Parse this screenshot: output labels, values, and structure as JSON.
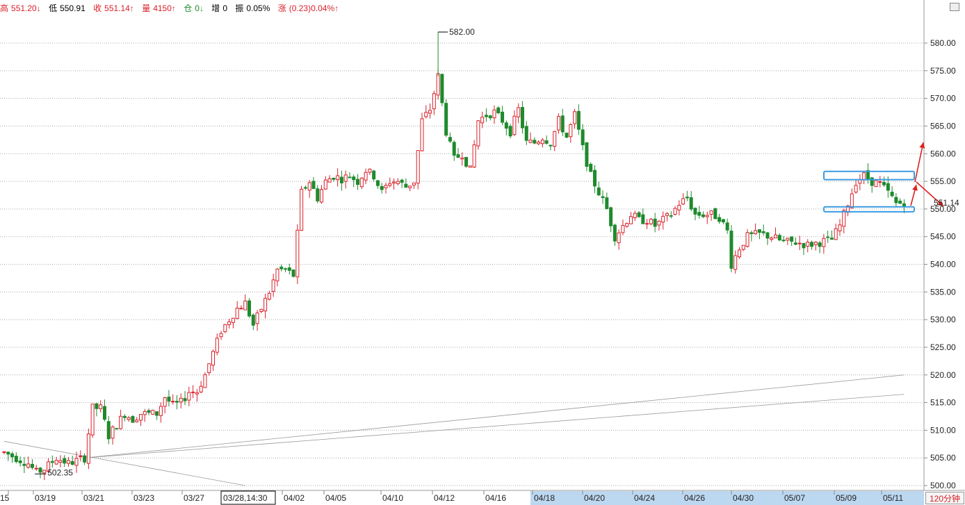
{
  "status": {
    "high_label": "高",
    "high_value": "551.20↓",
    "low_label": "低",
    "low_value": "550.91",
    "close_label": "收",
    "close_value": "551.14↑",
    "volume_label": "量",
    "volume_value": "4150↑",
    "oi_label": "仓",
    "oi_value": "0↓",
    "oi_change_label": "增",
    "oi_change_value": "0",
    "amplitude_label": "振",
    "amplitude_value": "0.05%",
    "change_label": "涨",
    "change_value": "(0.23)0.04%↑"
  },
  "timeframe": "120分钟",
  "cursor_time": "03/28,14:30",
  "colors": {
    "up": "#d9202a",
    "down": "#1e8a2c",
    "highlight_box": "#3a9be0",
    "arrow": "#e02020",
    "date_highlight": "#bcd7f0"
  },
  "chart_data": {
    "type": "candlestick",
    "ylim": [
      500,
      584
    ],
    "grid": true,
    "price_axis_side": "right",
    "price_ticks": [
      "580.00",
      "575.00",
      "570.00",
      "565.00",
      "560.00",
      "555.00",
      "550.00",
      "545.00",
      "540.00",
      "535.00",
      "530.00",
      "525.00",
      "520.00",
      "515.00",
      "510.00",
      "505.00",
      "500.00"
    ],
    "price_tick_values": [
      580,
      575,
      570,
      565,
      560,
      555,
      550,
      545,
      540,
      535,
      530,
      525,
      520,
      515,
      510,
      505,
      500
    ],
    "date_labels": [
      "15",
      "03/19",
      "03/21",
      "03/23",
      "03/27",
      "04/02",
      "04/05",
      "04/10",
      "04/12",
      "04/16",
      "04/18",
      "04/20",
      "04/24",
      "04/26",
      "04/30",
      "05/07",
      "05/09",
      "05/11"
    ],
    "last_price_label": "551.14",
    "annotations": [
      {
        "text": "582.00",
        "value": 582.0,
        "kind": "high"
      },
      {
        "text": "502.35",
        "value": 502.35,
        "kind": "low"
      }
    ],
    "zones": [
      {
        "low": 555.3,
        "high": 556.8
      },
      {
        "low": 549.5,
        "high": 550.4
      }
    ],
    "path_points": [
      [
        0,
        506
      ],
      [
        6,
        504
      ],
      [
        8,
        502.35
      ],
      [
        10,
        503
      ],
      [
        13,
        505
      ],
      [
        16,
        504
      ],
      [
        18,
        504.5
      ],
      [
        20,
        505
      ],
      [
        22,
        514
      ],
      [
        24,
        514
      ],
      [
        26,
        509
      ],
      [
        28,
        511
      ],
      [
        30,
        513
      ],
      [
        32,
        512
      ],
      [
        34,
        513
      ],
      [
        36,
        513
      ],
      [
        38,
        513
      ],
      [
        40,
        516
      ],
      [
        42,
        514.5
      ],
      [
        44,
        515
      ],
      [
        46,
        517
      ],
      [
        48,
        517
      ],
      [
        50,
        520
      ],
      [
        52,
        524
      ],
      [
        54,
        528
      ],
      [
        56,
        530
      ],
      [
        58,
        532
      ],
      [
        60,
        533
      ],
      [
        62,
        529
      ],
      [
        64,
        532
      ],
      [
        66,
        535
      ],
      [
        68,
        539
      ],
      [
        70,
        539
      ],
      [
        72,
        538
      ],
      [
        74,
        553
      ],
      [
        76,
        555
      ],
      [
        78,
        552
      ],
      [
        80,
        555
      ],
      [
        82,
        556
      ],
      [
        84,
        555.5
      ],
      [
        86,
        556
      ],
      [
        88,
        555
      ],
      [
        90,
        557
      ],
      [
        92,
        556
      ],
      [
        94,
        553
      ],
      [
        96,
        555
      ],
      [
        98,
        555
      ],
      [
        100,
        554
      ],
      [
        102,
        555
      ],
      [
        104,
        566
      ],
      [
        106,
        568
      ],
      [
        108,
        574
      ],
      [
        110,
        564
      ],
      [
        112,
        559
      ],
      [
        114,
        560
      ],
      [
        116,
        557
      ],
      [
        118,
        566
      ],
      [
        120,
        567
      ],
      [
        122,
        567.5
      ],
      [
        124,
        566
      ],
      [
        126,
        564
      ],
      [
        128,
        568
      ],
      [
        130,
        562
      ],
      [
        132,
        562
      ],
      [
        134,
        563
      ],
      [
        136,
        562
      ],
      [
        138,
        566
      ],
      [
        140,
        563
      ],
      [
        142,
        567
      ],
      [
        144,
        561
      ],
      [
        146,
        556
      ],
      [
        148,
        553
      ],
      [
        150,
        550
      ],
      [
        152,
        545
      ],
      [
        154,
        547
      ],
      [
        156,
        549
      ],
      [
        158,
        548
      ],
      [
        160,
        548
      ],
      [
        162,
        547
      ],
      [
        164,
        548
      ],
      [
        166,
        549
      ],
      [
        168,
        551
      ],
      [
        170,
        552
      ],
      [
        172,
        549
      ],
      [
        174,
        549
      ],
      [
        176,
        549
      ],
      [
        178,
        548.5
      ],
      [
        180,
        546
      ],
      [
        181,
        540
      ],
      [
        183,
        543
      ],
      [
        185,
        545
      ],
      [
        188,
        545.5
      ],
      [
        191,
        545
      ],
      [
        194,
        544
      ],
      [
        197,
        544
      ],
      [
        200,
        543.5
      ],
      [
        203,
        544
      ],
      [
        206,
        544.5
      ],
      [
        208,
        547
      ],
      [
        210,
        551
      ],
      [
        212,
        555
      ],
      [
        214,
        556
      ],
      [
        216,
        555
      ],
      [
        218,
        554.5
      ],
      [
        220,
        553
      ],
      [
        222,
        551
      ],
      [
        224,
        551.14
      ]
    ],
    "trendlines": [
      {
        "from": [
          20,
          505
        ],
        "to": [
          224,
          520
        ]
      },
      {
        "from": [
          20,
          505
        ],
        "to": [
          224,
          516.5
        ]
      },
      {
        "from": [
          0,
          508
        ],
        "to": [
          60,
          500
        ]
      }
    ]
  }
}
